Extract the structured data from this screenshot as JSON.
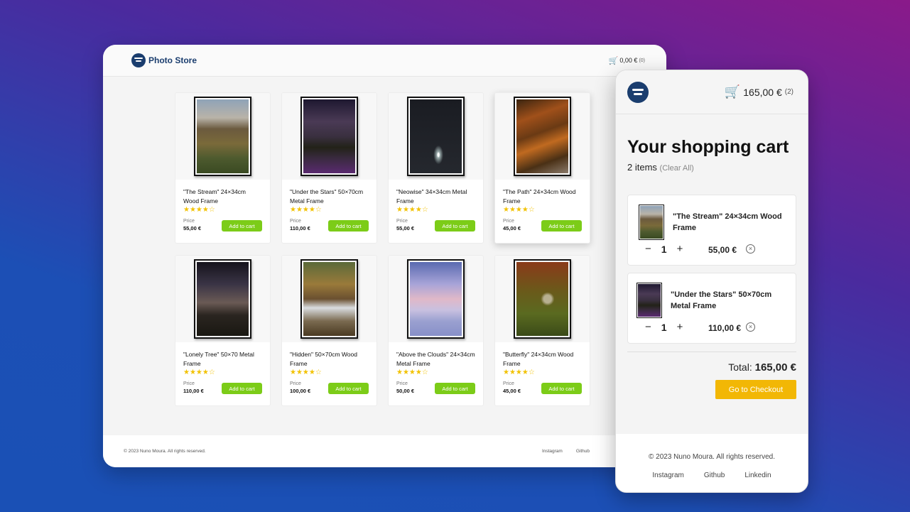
{
  "brand": {
    "name": "Photo Store"
  },
  "desktop": {
    "cart": {
      "amount": "0,00 €",
      "count": "(0)"
    },
    "products": [
      {
        "title": "\"The Stream\" 24×34cm Wood Frame",
        "price_label": "Price",
        "price": "55,00 €",
        "button": "Add to cart",
        "stars": "★★★★☆",
        "image": "mountain"
      },
      {
        "title": "\"Under the Stars\" 50×70cm Metal Frame",
        "price_label": "Price",
        "price": "110,00 €",
        "button": "Add to cart",
        "stars": "★★★★☆",
        "image": "stars"
      },
      {
        "title": "\"Neowise\" 34×34cm Metal Frame",
        "price_label": "Price",
        "price": "55,00 €",
        "button": "Add to cart",
        "stars": "★★★★☆",
        "image": "comet"
      },
      {
        "title": "\"The Path\" 24×34cm Wood Frame",
        "price_label": "Price",
        "price": "45,00 €",
        "button": "Add to cart",
        "stars": "★★★★☆",
        "image": "path"
      },
      {
        "title": "\"Lonely Tree\" 50×70 Metal Frame",
        "price_label": "Price",
        "price": "110,00 €",
        "button": "Add to cart",
        "stars": "★★★★☆",
        "image": "tree"
      },
      {
        "title": "\"Hidden\" 50×70cm Wood Frame",
        "price_label": "Price",
        "price": "100,00 €",
        "button": "Add to cart",
        "stars": "★★★★☆",
        "image": "falls"
      },
      {
        "title": "\"Above the Clouds\" 24×34cm Metal Frame",
        "price_label": "Price",
        "price": "50,00 €",
        "button": "Add to cart",
        "stars": "★★★★☆",
        "image": "clouds"
      },
      {
        "title": "\"Butterfly\" 24×34cm Wood Frame",
        "price_label": "Price",
        "price": "45,00 €",
        "button": "Add to cart",
        "stars": "★★★★☆",
        "image": "butterfly"
      }
    ],
    "footer": {
      "copyright": "© 2023 Nuno Moura. All rights reserved.",
      "links": [
        "Instagram",
        "Github"
      ]
    }
  },
  "mobile": {
    "cart": {
      "amount": "165,00 €",
      "count": "(2)"
    },
    "title": "Your shopping cart",
    "items_count": "2 items",
    "clear_label": "(Clear All)",
    "items": [
      {
        "name": "\"The Stream\" 24×34cm Wood Frame",
        "qty": "1",
        "price": "55,00 €",
        "image": "mountain",
        "minus": "−",
        "plus": "+",
        "remove": "×"
      },
      {
        "name": "\"Under the Stars\" 50×70cm Metal Frame",
        "qty": "1",
        "price": "110,00 €",
        "image": "stars",
        "minus": "−",
        "plus": "+",
        "remove": "×"
      }
    ],
    "total_label": "Total:",
    "total_value": "165,00 €",
    "checkout": "Go to Checkout",
    "footer": {
      "copyright": "© 2023 Nuno Moura. All rights reserved.",
      "links": [
        "Instagram",
        "Github",
        "Linkedin"
      ]
    }
  },
  "icons": {
    "cart": "🛒"
  },
  "colors": {
    "brand": "#1a3d6e",
    "add_button": "#7ccc18",
    "checkout": "#f2b705",
    "stars": "#f2c200"
  }
}
